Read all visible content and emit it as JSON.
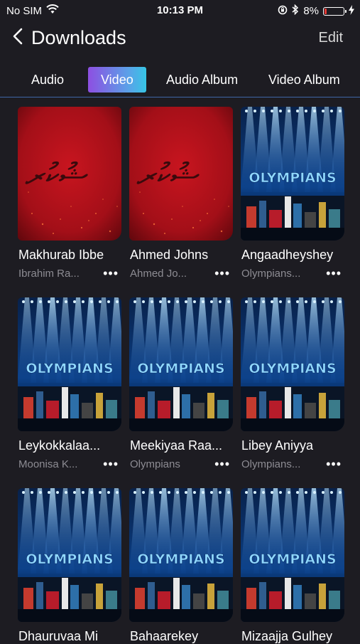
{
  "status": {
    "carrier": "No SIM",
    "time": "10:13 PM",
    "battery": "8%"
  },
  "header": {
    "title": "Downloads",
    "edit_label": "Edit"
  },
  "tabs": [
    {
      "label": "Audio",
      "active": false
    },
    {
      "label": "Video",
      "active": true
    },
    {
      "label": "Audio Album",
      "active": false
    },
    {
      "label": "Video Album",
      "active": false
    }
  ],
  "videos": [
    {
      "title": "Makhurab Ibbe",
      "artist": "Ibrahim Ra...",
      "thumb": "red-script"
    },
    {
      "title": "Ahmed Johns",
      "artist": "Ahmed Jo...",
      "thumb": "red-script"
    },
    {
      "title": "Angaadheyshey",
      "artist": "Olympians...",
      "thumb": "olympians-stage"
    },
    {
      "title": "Leykokkalaa...",
      "artist": "Moonisa K...",
      "thumb": "olympians-stage"
    },
    {
      "title": "Meekiyaa Raa...",
      "artist": "Olympians",
      "thumb": "olympians-stage"
    },
    {
      "title": "Libey Aniyya",
      "artist": "Olympians...",
      "thumb": "olympians-stage"
    },
    {
      "title": "Dhauruvaa Mi",
      "artist": "",
      "thumb": "olympians-stage"
    },
    {
      "title": "Bahaarekey",
      "artist": "",
      "thumb": "olympians-stage"
    },
    {
      "title": "Mizaajja Gulhey",
      "artist": "",
      "thumb": "olympians-stage"
    }
  ],
  "thumb_text": {
    "olympians": "OLYMPIANS",
    "script": "ޝުކުރ"
  },
  "colors": {
    "accent_start": "#8d4fe2",
    "accent_end": "#36c5e6",
    "background": "#1d1c22",
    "red_thumb": "#b3141c",
    "stage_blue": "#1a63c4"
  },
  "icons": {
    "back": "chevron-left-icon",
    "more": "more-dots-icon",
    "wifi": "wifi-icon",
    "bluetooth": "bluetooth-icon",
    "battery": "battery-icon"
  }
}
